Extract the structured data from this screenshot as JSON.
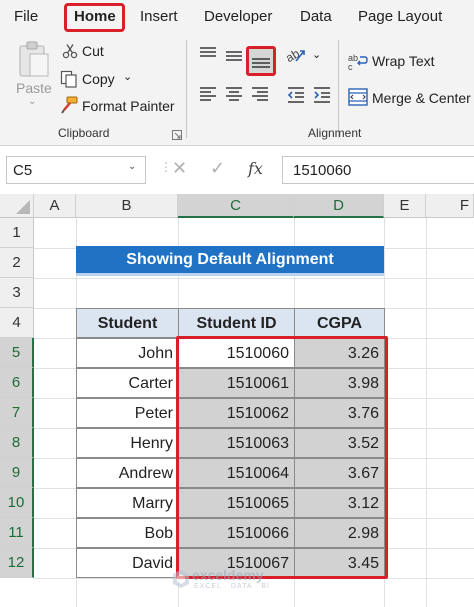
{
  "menu": {
    "tabs": [
      {
        "label": "File"
      },
      {
        "label": "Home",
        "active": true
      },
      {
        "label": "Insert"
      },
      {
        "label": "Developer"
      },
      {
        "label": "Data"
      },
      {
        "label": "Page Layout"
      }
    ]
  },
  "clipboard": {
    "paste_label": "Paste",
    "cut_label": "Cut",
    "copy_label": "Copy",
    "format_painter_label": "Format Painter",
    "group_label": "Clipboard"
  },
  "alignment": {
    "wrap_text_label": "Wrap Text",
    "merge_center_label": "Merge & Center",
    "group_label": "Alignment"
  },
  "formula_bar": {
    "name_box": "C5",
    "fx_label": "fx",
    "value": "1510060"
  },
  "grid": {
    "columns": [
      "A",
      "B",
      "C",
      "D",
      "E",
      "F"
    ],
    "rows": [
      "1",
      "2",
      "3",
      "4",
      "5",
      "6",
      "7",
      "8",
      "9",
      "10",
      "11",
      "12"
    ]
  },
  "sheet": {
    "title": "Showing Default Alignment",
    "headers": [
      "Student",
      "Student ID",
      "CGPA"
    ],
    "records": [
      {
        "student": "John",
        "id": "1510060",
        "cgpa": "3.26"
      },
      {
        "student": "Carter",
        "id": "1510061",
        "cgpa": "3.98"
      },
      {
        "student": "Peter",
        "id": "1510062",
        "cgpa": "3.76"
      },
      {
        "student": "Henry",
        "id": "1510063",
        "cgpa": "3.52"
      },
      {
        "student": "Andrew",
        "id": "1510064",
        "cgpa": "3.67"
      },
      {
        "student": "Marry",
        "id": "1510065",
        "cgpa": "3.12"
      },
      {
        "student": "Bob",
        "id": "1510066",
        "cgpa": "2.98"
      },
      {
        "student": "David",
        "id": "1510067",
        "cgpa": "3.45"
      }
    ]
  },
  "watermark": {
    "name": "exceldemy",
    "tagline": "EXCEL · DATA · BI"
  },
  "colors": {
    "accent_red": "#d9202a",
    "title_blue": "#1f72c4",
    "header_fill": "#dbe5f1",
    "selection_fill": "#d2d2d2",
    "excel_green": "#217346"
  }
}
